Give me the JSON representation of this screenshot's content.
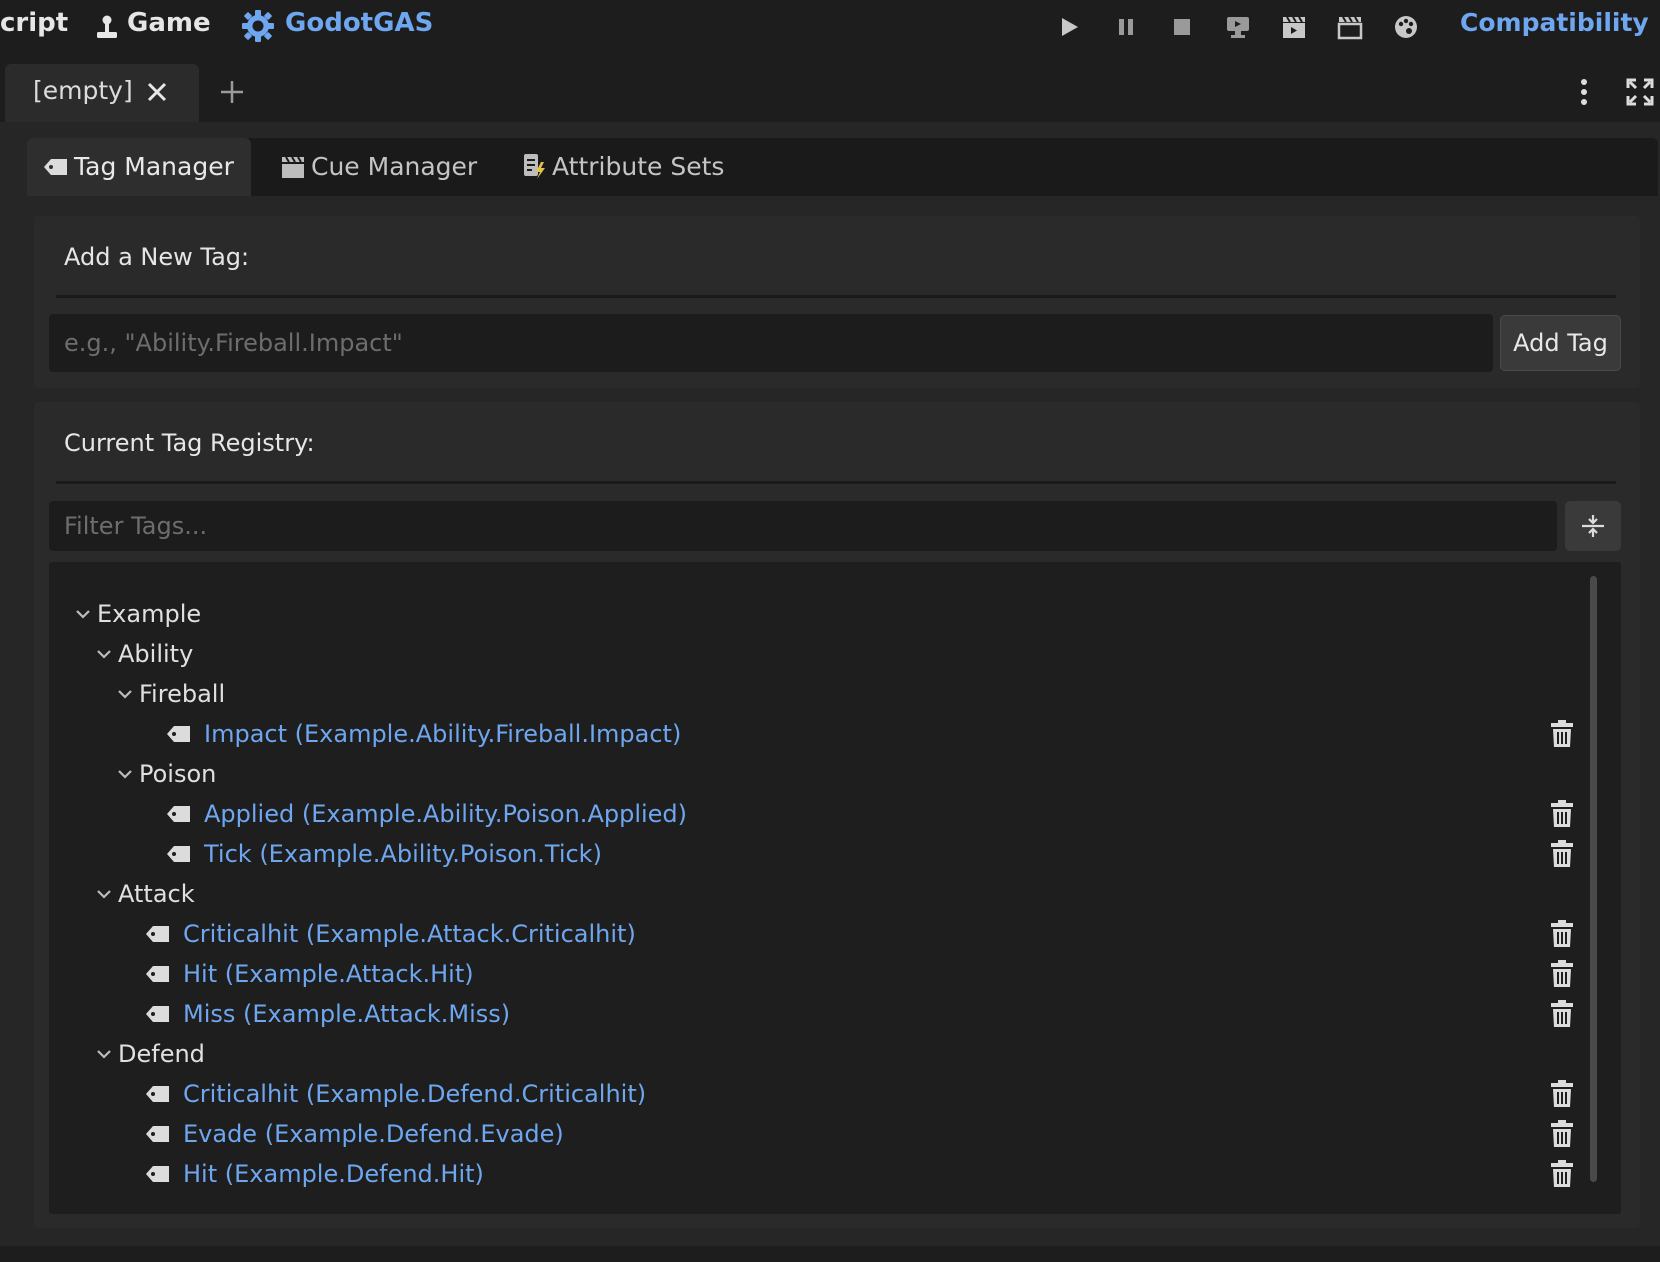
{
  "topbar": {
    "script_label": "cript",
    "game_label": "Game",
    "plugin_label": "GodotGAS",
    "renderer_label": "Compatibility",
    "icons": [
      "play-icon",
      "pause-icon",
      "stop-icon",
      "remote-debug-icon",
      "movie-icon",
      "clapper-icon",
      "palette-icon"
    ]
  },
  "scene_tabs": {
    "active_label": "[empty]",
    "close_icon": "close-icon",
    "add_icon": "plus-icon"
  },
  "dock_tabs": [
    {
      "label": "Tag Manager",
      "icon": "tag-icon"
    },
    {
      "label": "Cue Manager",
      "icon": "clapper-icon"
    },
    {
      "label": "Attribute Sets",
      "icon": "scroll-icon"
    }
  ],
  "add_panel": {
    "title": "Add a New Tag:",
    "placeholder": "e.g., \"Ability.Fireball.Impact\"",
    "button_label": "Add Tag"
  },
  "registry": {
    "title": "Current Tag Registry:",
    "filter_placeholder": "Filter Tags...",
    "tree": [
      {
        "kind": "group",
        "depth": 0,
        "label": "Example"
      },
      {
        "kind": "group",
        "depth": 1,
        "label": "Ability"
      },
      {
        "kind": "group",
        "depth": 2,
        "label": "Fireball"
      },
      {
        "kind": "leaf",
        "depth": 3,
        "label": "Impact (Example.Ability.Fireball.Impact)"
      },
      {
        "kind": "group",
        "depth": 2,
        "label": "Poison"
      },
      {
        "kind": "leaf",
        "depth": 3,
        "label": "Applied (Example.Ability.Poison.Applied)"
      },
      {
        "kind": "leaf",
        "depth": 3,
        "label": "Tick (Example.Ability.Poison.Tick)"
      },
      {
        "kind": "group",
        "depth": 1,
        "label": "Attack"
      },
      {
        "kind": "leaf",
        "depth": 2,
        "label": "Criticalhit (Example.Attack.Criticalhit)"
      },
      {
        "kind": "leaf",
        "depth": 2,
        "label": "Hit (Example.Attack.Hit)"
      },
      {
        "kind": "leaf",
        "depth": 2,
        "label": "Miss (Example.Attack.Miss)"
      },
      {
        "kind": "group",
        "depth": 1,
        "label": "Defend"
      },
      {
        "kind": "leaf",
        "depth": 2,
        "label": "Criticalhit (Example.Defend.Criticalhit)"
      },
      {
        "kind": "leaf",
        "depth": 2,
        "label": "Evade (Example.Defend.Evade)"
      },
      {
        "kind": "leaf",
        "depth": 2,
        "label": "Hit (Example.Defend.Hit)"
      }
    ]
  },
  "colors": {
    "accent": "#6ea6ef",
    "background": "#262626",
    "panel": "#2a2a2a"
  }
}
